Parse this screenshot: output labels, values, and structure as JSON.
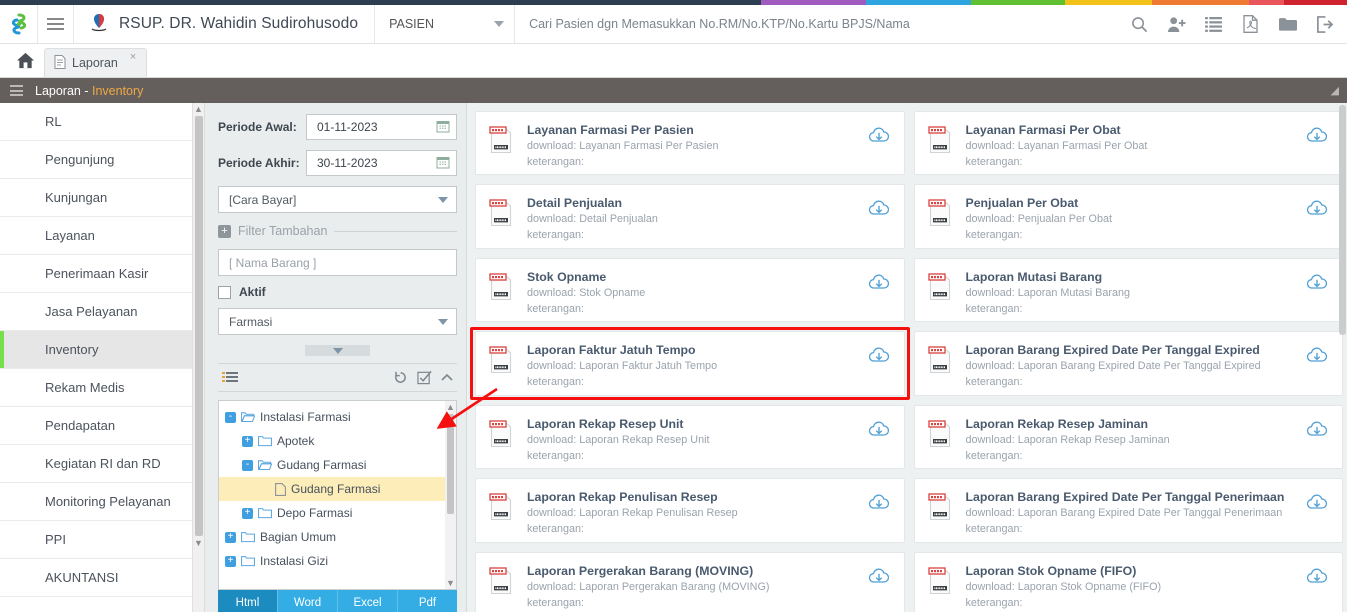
{
  "colorstrip": [
    {
      "color": "#2c3e50",
      "w": 56.5
    },
    {
      "color": "#a05bbf",
      "w": 7.8
    },
    {
      "color": "#2fa5e0",
      "w": 7.8
    },
    {
      "color": "#5fc131",
      "w": 7.0
    },
    {
      "color": "#f2c21a",
      "w": 6.4
    },
    {
      "color": "#ef7b33",
      "w": 7.2
    },
    {
      "color": "#e8555a",
      "w": 2.6
    },
    {
      "color": "#cf2330",
      "w": 4.7
    }
  ],
  "header": {
    "logo_icon": "pinwheel-logo-icon",
    "menu_icon": "hamburger-menu-icon",
    "brand_mark_icon": "hospital-mark-icon",
    "brand_title": "RSUP. DR. Wahidin Sudirohusodo",
    "search_scope": "PASIEN",
    "search_placeholder": "Cari Pasien dgn Memasukkan No.RM/No.KTP/No.Kartu BPJS/Nama",
    "search_value": "",
    "icons": [
      {
        "name": "search-icon"
      },
      {
        "name": "add-user-icon"
      },
      {
        "name": "list-icon"
      },
      {
        "name": "pdf-file-icon"
      },
      {
        "name": "folder-icon"
      },
      {
        "name": "logout-icon"
      }
    ]
  },
  "tabs": {
    "home_icon": "home-icon",
    "items": [
      {
        "label": "Laporan",
        "icon": "document-icon",
        "close": "×",
        "active": true
      }
    ]
  },
  "breadcrumb": {
    "menu_icon": "hamburger-menu-icon",
    "prefix": "Laporan - ",
    "accent": "Inventory",
    "right_icon": "resize-icon"
  },
  "sidebar": {
    "items": [
      {
        "label": "RL",
        "active": false
      },
      {
        "label": "Pengunjung",
        "active": false
      },
      {
        "label": "Kunjungan",
        "active": false
      },
      {
        "label": "Layanan",
        "active": false
      },
      {
        "label": "Penerimaan Kasir",
        "active": false
      },
      {
        "label": "Jasa Pelayanan",
        "active": false
      },
      {
        "label": "Inventory",
        "active": true
      },
      {
        "label": "Rekam Medis",
        "active": false
      },
      {
        "label": "Pendapatan",
        "active": false
      },
      {
        "label": "Kegiatan RI dan RD",
        "active": false
      },
      {
        "label": "Monitoring Pelayanan",
        "active": false
      },
      {
        "label": "PPI",
        "active": false
      },
      {
        "label": "AKUNTANSI",
        "active": false
      }
    ],
    "scroll_up": "▲",
    "scroll_down": "▼"
  },
  "filters": {
    "periode_awal_label": "Periode Awal:",
    "periode_awal_value": "01-11-2023",
    "periode_akhir_label": "Periode Akhir:",
    "periode_akhir_value": "30-11-2023",
    "calendar_icon": "calendar-icon",
    "cara_bayar_value": "[Cara Bayar]",
    "filter_tambahan_label": "Filter Tambahan",
    "plus_symbol": "+",
    "nama_barang_placeholder": "[ Nama Barang ]",
    "nama_barang_value": "",
    "aktif_label": "Aktif",
    "aktif_checked": false,
    "unit_value": "Farmasi",
    "toolbar": {
      "list_icon": "list-lines-icon",
      "refresh_icon": "refresh-icon",
      "checkall_icon": "check-square-icon",
      "collapse_icon": "chevron-up-icon"
    },
    "tree": [
      {
        "label": "Instalasi Farmasi",
        "depth": 0,
        "expander": "-",
        "icon": "folder-open-icon",
        "selected": false
      },
      {
        "label": "Apotek",
        "depth": 1,
        "expander": "+",
        "icon": "folder-icon",
        "selected": false
      },
      {
        "label": "Gudang Farmasi",
        "depth": 1,
        "expander": "-",
        "icon": "folder-open-icon",
        "selected": false
      },
      {
        "label": "Gudang Farmasi",
        "depth": 2,
        "expander": "",
        "icon": "file-icon",
        "selected": true
      },
      {
        "label": "Depo Farmasi",
        "depth": 1,
        "expander": "+",
        "icon": "folder-icon",
        "selected": false
      },
      {
        "label": "Bagian Umum",
        "depth": 0,
        "expander": "+",
        "icon": "folder-icon",
        "selected": false
      },
      {
        "label": "Instalasi Gizi",
        "depth": 0,
        "expander": "+",
        "icon": "folder-icon",
        "selected": false
      }
    ],
    "export_buttons": [
      {
        "label": "Html",
        "active": true
      },
      {
        "label": "Word",
        "active": false
      },
      {
        "label": "Excel",
        "active": false
      },
      {
        "label": "Pdf",
        "active": false
      }
    ]
  },
  "reports": {
    "download_prefix": "download: ",
    "keterangan_label": "keterangan:",
    "report_icon": "report-document-icon",
    "download_icon": "cloud-download-icon",
    "left_column": [
      {
        "title": "Layanan Farmasi Per Pasien",
        "keterangan": "",
        "highlighted": false
      },
      {
        "title": "Detail Penjualan",
        "keterangan": "",
        "highlighted": false
      },
      {
        "title": "Stok Opname",
        "keterangan": "",
        "highlighted": false
      },
      {
        "title": "Laporan Faktur Jatuh Tempo",
        "keterangan": "",
        "highlighted": true
      },
      {
        "title": "Laporan Rekap Resep Unit",
        "keterangan": "",
        "highlighted": false
      },
      {
        "title": "Laporan Rekap Penulisan Resep",
        "keterangan": "",
        "highlighted": false
      },
      {
        "title": "Laporan Pergerakan Barang (MOVING)",
        "keterangan": "",
        "highlighted": false
      }
    ],
    "right_column": [
      {
        "title": "Layanan Farmasi Per Obat",
        "keterangan": "",
        "highlighted": false
      },
      {
        "title": "Penjualan Per Obat",
        "keterangan": "",
        "highlighted": false
      },
      {
        "title": "Laporan Mutasi Barang",
        "keterangan": "",
        "highlighted": false
      },
      {
        "title": "Laporan Barang Expired Date Per Tanggal Expired",
        "keterangan": "",
        "highlighted": false
      },
      {
        "title": "Laporan Rekap Resep Jaminan",
        "keterangan": "",
        "highlighted": false
      },
      {
        "title": "Laporan Barang Expired Date Per Tanggal Penerimaan",
        "keterangan": "",
        "highlighted": false
      },
      {
        "title": "Laporan Stok Opname (FIFO)",
        "keterangan": "",
        "highlighted": false
      }
    ]
  },
  "annotation": {
    "color": "#f5100f",
    "target": "Laporan Faktur Jatuh Tempo"
  }
}
